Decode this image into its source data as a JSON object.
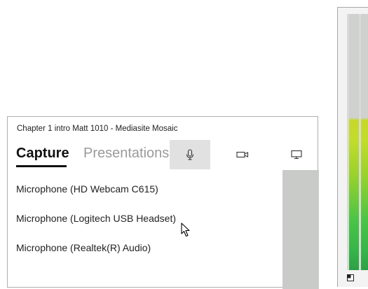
{
  "window": {
    "title": "Chapter 1 intro Matt 1010 - Mediasite Mosaic"
  },
  "tabs": [
    {
      "label": "Capture",
      "active": true
    },
    {
      "label": "Presentations",
      "active": false
    }
  ],
  "source_buttons": [
    {
      "icon": "microphone-icon",
      "selected": true
    },
    {
      "icon": "camera-icon",
      "selected": false
    },
    {
      "icon": "monitor-icon",
      "selected": false
    }
  ],
  "devices": [
    "Microphone (HD Webcam C615)",
    "Microphone (Logitech USB Headset)",
    "Microphone (Realtek(R) Audio)"
  ],
  "colors": {
    "selected_button_bg": "#e1e1e1",
    "inactive_tab": "#9a9a9a",
    "scroll_panel": "#c9cbc9",
    "meter_green": "#35b449",
    "meter_yellow": "#c7d82a"
  }
}
